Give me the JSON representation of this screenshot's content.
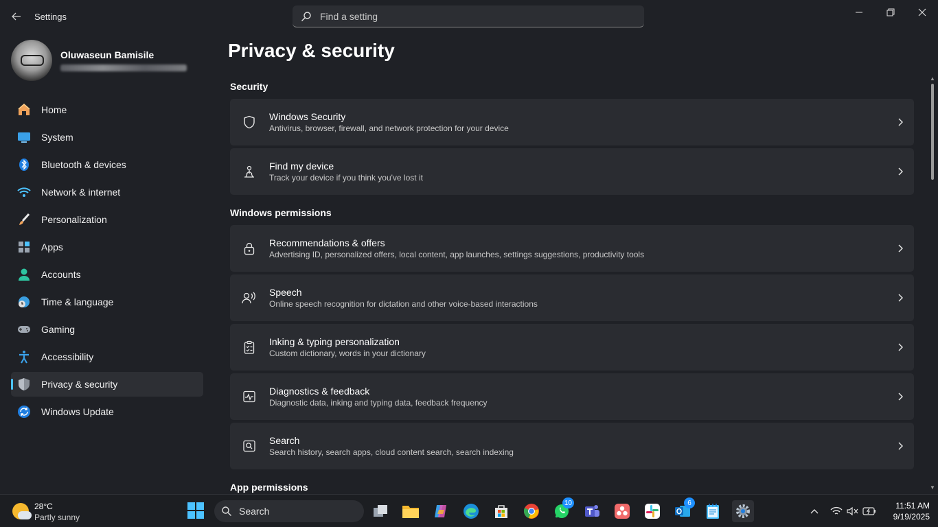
{
  "window": {
    "app_title": "Settings",
    "search_placeholder": "Find a setting"
  },
  "profile": {
    "name": "Oluwaseun Bamisile"
  },
  "sidebar": {
    "items": [
      {
        "label": "Home",
        "icon": "home-icon"
      },
      {
        "label": "System",
        "icon": "system-icon"
      },
      {
        "label": "Bluetooth & devices",
        "icon": "bluetooth-icon"
      },
      {
        "label": "Network & internet",
        "icon": "wifi-icon"
      },
      {
        "label": "Personalization",
        "icon": "paintbrush-icon"
      },
      {
        "label": "Apps",
        "icon": "apps-icon"
      },
      {
        "label": "Accounts",
        "icon": "accounts-icon"
      },
      {
        "label": "Time & language",
        "icon": "clock-globe-icon"
      },
      {
        "label": "Gaming",
        "icon": "gamepad-icon"
      },
      {
        "label": "Accessibility",
        "icon": "accessibility-icon"
      },
      {
        "label": "Privacy & security",
        "icon": "shield-icon",
        "active": true
      },
      {
        "label": "Windows Update",
        "icon": "update-icon"
      }
    ]
  },
  "main": {
    "page_title": "Privacy & security",
    "sections": [
      {
        "title": "Security",
        "cards": [
          {
            "title": "Windows Security",
            "desc": "Antivirus, browser, firewall, and network protection for your device",
            "icon": "shield-outline-icon"
          },
          {
            "title": "Find my device",
            "desc": "Track your device if you think you've lost it",
            "icon": "person-pin-icon"
          }
        ]
      },
      {
        "title": "Windows permissions",
        "cards": [
          {
            "title": "Recommendations & offers",
            "desc": "Advertising ID, personalized offers, local content, app launches, settings suggestions, productivity tools",
            "icon": "lock-icon"
          },
          {
            "title": "Speech",
            "desc": "Online speech recognition for dictation and other voice-based interactions",
            "icon": "speech-icon"
          },
          {
            "title": "Inking & typing personalization",
            "desc": "Custom dictionary, words in your dictionary",
            "icon": "clipboard-check-icon"
          },
          {
            "title": "Diagnostics & feedback",
            "desc": "Diagnostic data, inking and typing data, feedback frequency",
            "icon": "diagnostics-icon"
          },
          {
            "title": "Search",
            "desc": "Search history, search apps, cloud content search, search indexing",
            "icon": "search-box-icon"
          }
        ]
      },
      {
        "title": "App permissions",
        "cards": []
      }
    ]
  },
  "taskbar": {
    "weather_temp": "28°C",
    "weather_condition": "Partly sunny",
    "search_label": "Search",
    "whatsapp_badge": "10",
    "outlook_badge": "6",
    "time": "11:51 AM",
    "date": "9/19/2025"
  },
  "colors": {
    "accent": "#4cc2ff",
    "background": "#1f2126",
    "card": "#2a2c31"
  }
}
